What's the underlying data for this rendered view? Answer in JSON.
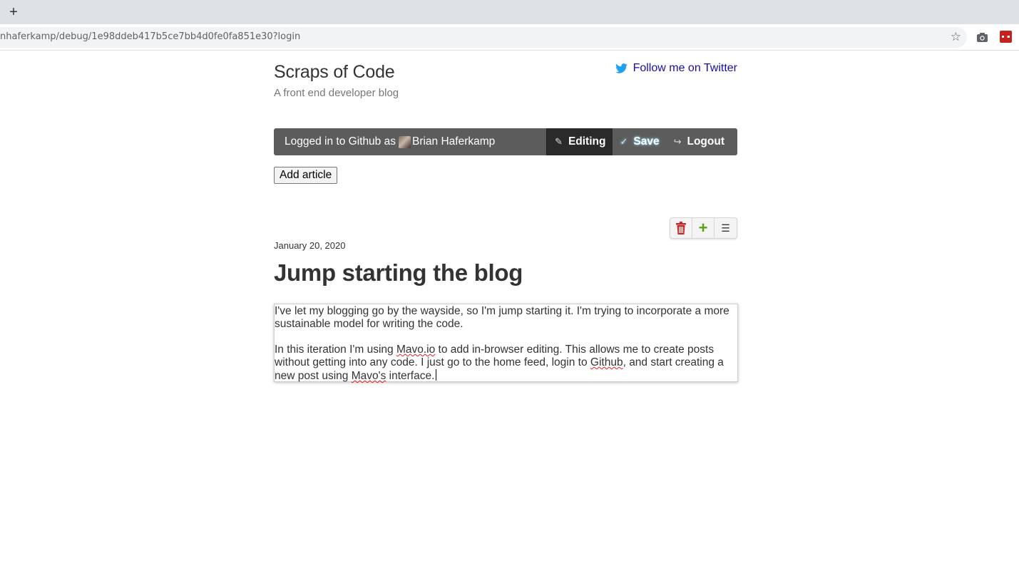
{
  "browser": {
    "new_tab_label": "+",
    "url": "nhaferkamp/debug/1e98ddeb417b5ce7bb4d0fe0fa851e30?login",
    "icons": [
      "star-icon",
      "camera-icon",
      "extension-icon"
    ]
  },
  "site": {
    "title": "Scraps of Code",
    "tagline": "A front end developer blog",
    "twitter_link": "Follow me on Twitter"
  },
  "mavo": {
    "logged_in_prefix": "Logged in to Github as",
    "user_name": "Brian Haferkamp",
    "editing_label": "Editing",
    "save_label": "Save",
    "logout_label": "Logout"
  },
  "actions": {
    "add_article": "Add article"
  },
  "post": {
    "date": "January 20, 2020",
    "title": "Jump starting the blog",
    "paragraph1": "I've let my blogging go by the wayside, so I'm jump starting it. I'm trying to incorporate a more sustainable model for writing the code.",
    "p2_a": "In this iteration I'm using ",
    "p2_mavo": "Mavo.io",
    "p2_b": " to add in-browser editing. This allows me to create posts without getting into any code. I just go to the home feed, login to ",
    "p2_github": "Github",
    "p2_c": ", and start creating a new post using ",
    "p2_mavos": "Mavo's",
    "p2_d": " interface."
  },
  "colors": {
    "mavo_bar": "#5c5c5c",
    "editing_bg": "#2a2a2a",
    "link": "#1a0dab",
    "twitter": "#1da1f2",
    "delete": "#c62828",
    "add": "#59a012"
  }
}
